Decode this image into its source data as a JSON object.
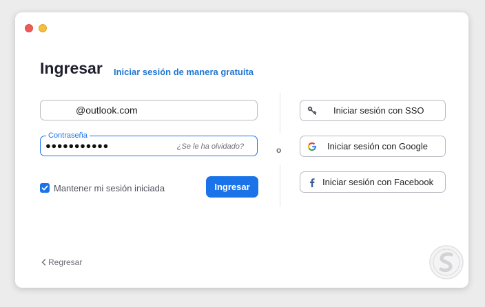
{
  "window": {
    "buttons": [
      "close",
      "minimize"
    ]
  },
  "header": {
    "title": "Ingresar",
    "free_link": "Iniciar sesión de manera gratuita"
  },
  "form": {
    "email_value": "@outlook.com",
    "password_label": "Contraseña",
    "password_value": "●●●●●●●●●●●",
    "forgot": "¿Se le ha olvidado?",
    "keep_signed_in": "Mantener mi sesión iniciada",
    "keep_checked": true,
    "signin": "Ingresar"
  },
  "separator": {
    "or": "o"
  },
  "sso": [
    {
      "label": "Iniciar sesión con SSO",
      "icon": "key-icon"
    },
    {
      "label": "Iniciar sesión con Google",
      "icon": "google-icon"
    },
    {
      "label": "Iniciar sesión con Facebook",
      "icon": "facebook-icon"
    }
  ],
  "footer": {
    "back": "Regresar"
  },
  "colors": {
    "accent": "#1a73e8",
    "link": "#1f76d2"
  }
}
